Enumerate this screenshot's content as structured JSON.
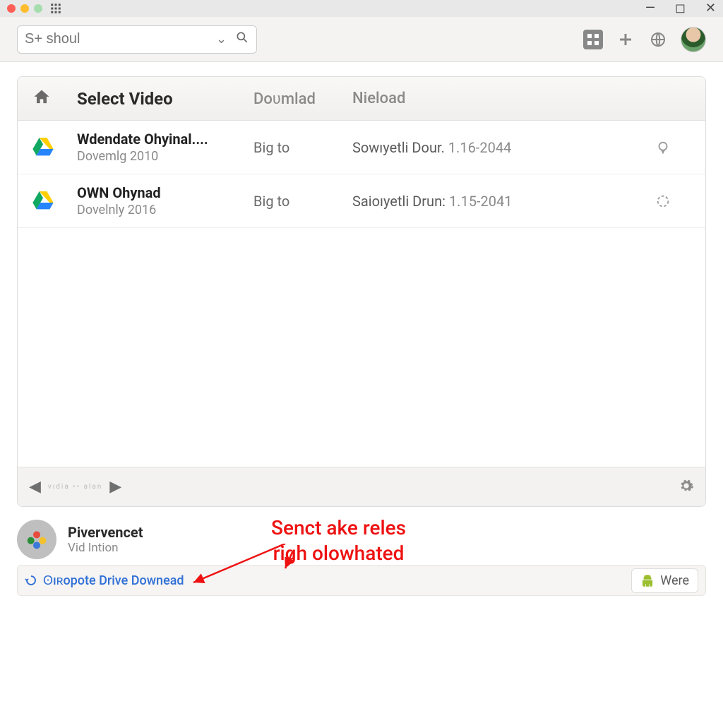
{
  "search": {
    "value": "S+ shoul"
  },
  "panel": {
    "title": "Select Video",
    "col_download": "Doʋmlad",
    "col_nieload": "Nieload"
  },
  "rows": [
    {
      "title": "Wdendate Ohyinal....",
      "subtitle": "Dovemlg 2010",
      "download": "Big to",
      "nieload_text": "Sowıyetli Dour.",
      "nieload_date": "1.16-2044",
      "status_icon": "bulb"
    },
    {
      "title": "OWN Ohynad",
      "subtitle": "Dovelnly 2016",
      "download": "Big to",
      "nieload_text": "Saioıyetli Drun:",
      "nieload_date": "1.15-2041",
      "status_icon": "spinner"
    }
  ],
  "footer": {
    "pager_text": "vıdia •• alan"
  },
  "account": {
    "name": "Pivervencet",
    "subtitle": "Vid Intion"
  },
  "annotation": {
    "text": "Senct ake reles\nrigh olowhated"
  },
  "bottombar": {
    "link": "ʘıʀopote Drive Downead",
    "button": "Were"
  }
}
